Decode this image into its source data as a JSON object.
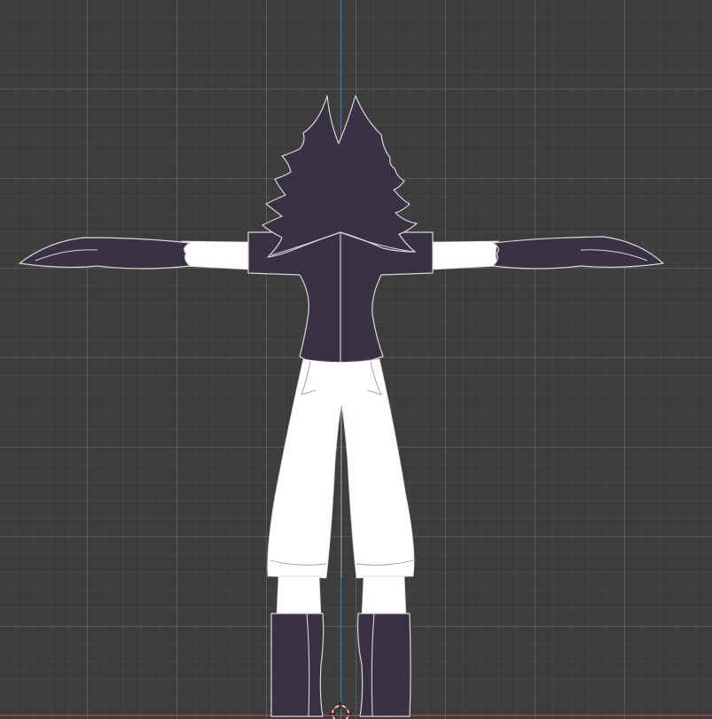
{
  "viewport": {
    "background": "#3d3d3d",
    "grid_major_color": "rgba(255,255,255,0.11)",
    "grid_minor_color": "rgba(255,255,255,0.045)",
    "axis_z_color": "#4a7fb0",
    "axis_x_color": "#a33a3a"
  },
  "model": {
    "pose": "t-pose",
    "view": "front-orthographic",
    "colors": {
      "dark": "#3a3144",
      "light": "#ffffff",
      "outline": "#d8d8d8"
    }
  },
  "icons": {
    "origin": "3d-cursor-icon"
  }
}
